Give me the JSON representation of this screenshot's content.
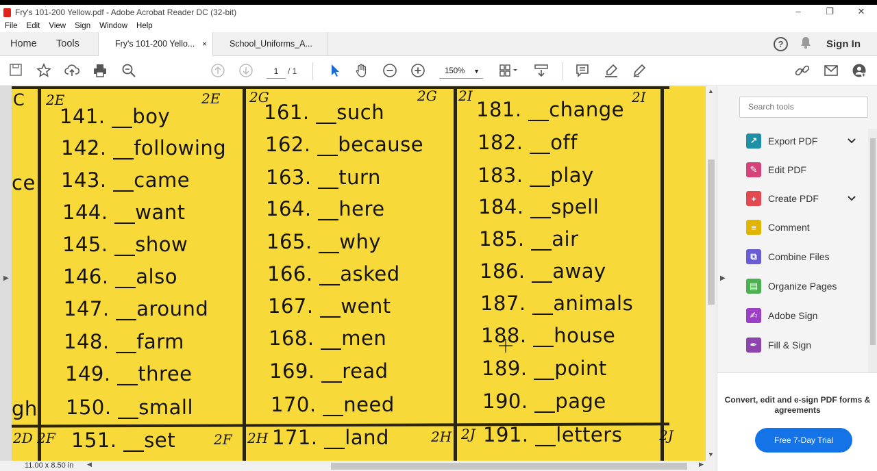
{
  "window": {
    "title": "Fry's 101-200 Yellow.pdf - Adobe Acrobat Reader DC (32-bit)",
    "controls": [
      "–",
      "❐",
      "✕"
    ]
  },
  "menu": [
    "File",
    "Edit",
    "View",
    "Sign",
    "Window",
    "Help"
  ],
  "tabs": {
    "home": "Home",
    "tools": "Tools",
    "docs": [
      {
        "label": "Fry's 101-200 Yello...",
        "close": "×"
      },
      {
        "label": "School_Uniforms_A..."
      }
    ],
    "help": "?",
    "sign_in": "Sign In"
  },
  "toolbar": {
    "page_current": "1",
    "page_total": "/ 1",
    "zoom": "150%",
    "icons": [
      "save-icon",
      "bookmark-star-icon",
      "upload-icon",
      "print-icon",
      "search-zoom-icon",
      "page-up-icon",
      "page-down-icon",
      "select-cursor-icon",
      "hand-icon",
      "zoom-out-icon",
      "zoom-in-icon",
      "page-layout-icon",
      "scroll-mode-icon",
      "comment-icon",
      "highlight-icon",
      "sign-pen-icon",
      "share-link-icon",
      "email-icon",
      "add-person-icon"
    ]
  },
  "document": {
    "partial_left": [
      "C",
      "ce",
      "gh"
    ],
    "columns": [
      {
        "header_left": "2E",
        "header_right": "2E",
        "items": [
          "141. __boy",
          "142. __following",
          "143. __came",
          "144. __want",
          "145. __show",
          "146. __also",
          "147. __around",
          "148. __farm",
          "149. __three",
          "150. __small"
        ],
        "footer_left": "2D 2F",
        "footer_item": "151. __set",
        "footer_right": "2F"
      },
      {
        "header_left": "2G",
        "header_right": "2G",
        "items": [
          "161. __such",
          "162. __because",
          "163. __turn",
          "164. __here",
          "165. __why",
          "166. __asked",
          "167. __went",
          "168. __men",
          "169. __read",
          "170. __need"
        ],
        "footer_left": "2H",
        "footer_item": "171. __land",
        "footer_right": "2H"
      },
      {
        "header_left": "2I",
        "header_right": "2I",
        "items": [
          "181. __change",
          "182. __off",
          "183. __play",
          "184. __spell",
          "185. __air",
          "186. __away",
          "187. __animals",
          "188. __house",
          "189. __point",
          "190. __page"
        ],
        "footer_left": "2J",
        "footer_item": "191. __letters",
        "footer_right": "2J"
      }
    ]
  },
  "status": {
    "page_size": "11.00 x 8.50 in"
  },
  "right_panel": {
    "search_placeholder": "Search tools",
    "tools": [
      {
        "label": "Export PDF",
        "icon": "export-pdf-icon",
        "color": "#1e8fa5",
        "expandable": true
      },
      {
        "label": "Edit PDF",
        "icon": "edit-pdf-icon",
        "color": "#d6437a",
        "expandable": false
      },
      {
        "label": "Create PDF",
        "icon": "create-pdf-icon",
        "color": "#e34850",
        "expandable": true
      },
      {
        "label": "Comment",
        "icon": "comment-tool-icon",
        "color": "#e2b500",
        "expandable": false
      },
      {
        "label": "Combine Files",
        "icon": "combine-files-icon",
        "color": "#6a5bd6",
        "expandable": false
      },
      {
        "label": "Organize Pages",
        "icon": "organize-pages-icon",
        "color": "#4caf50",
        "expandable": false
      },
      {
        "label": "Adobe Sign",
        "icon": "adobe-sign-icon",
        "color": "#9b3fc4",
        "expandable": false
      },
      {
        "label": "Fill & Sign",
        "icon": "fill-sign-icon",
        "color": "#8e44ad",
        "expandable": false
      }
    ],
    "promo_text": "Convert, edit and e-sign PDF forms & agreements",
    "promo_button": "Free 7-Day Trial"
  },
  "colors": {
    "page_yellow": "#f7d93a",
    "accent_blue": "#1473e6"
  }
}
